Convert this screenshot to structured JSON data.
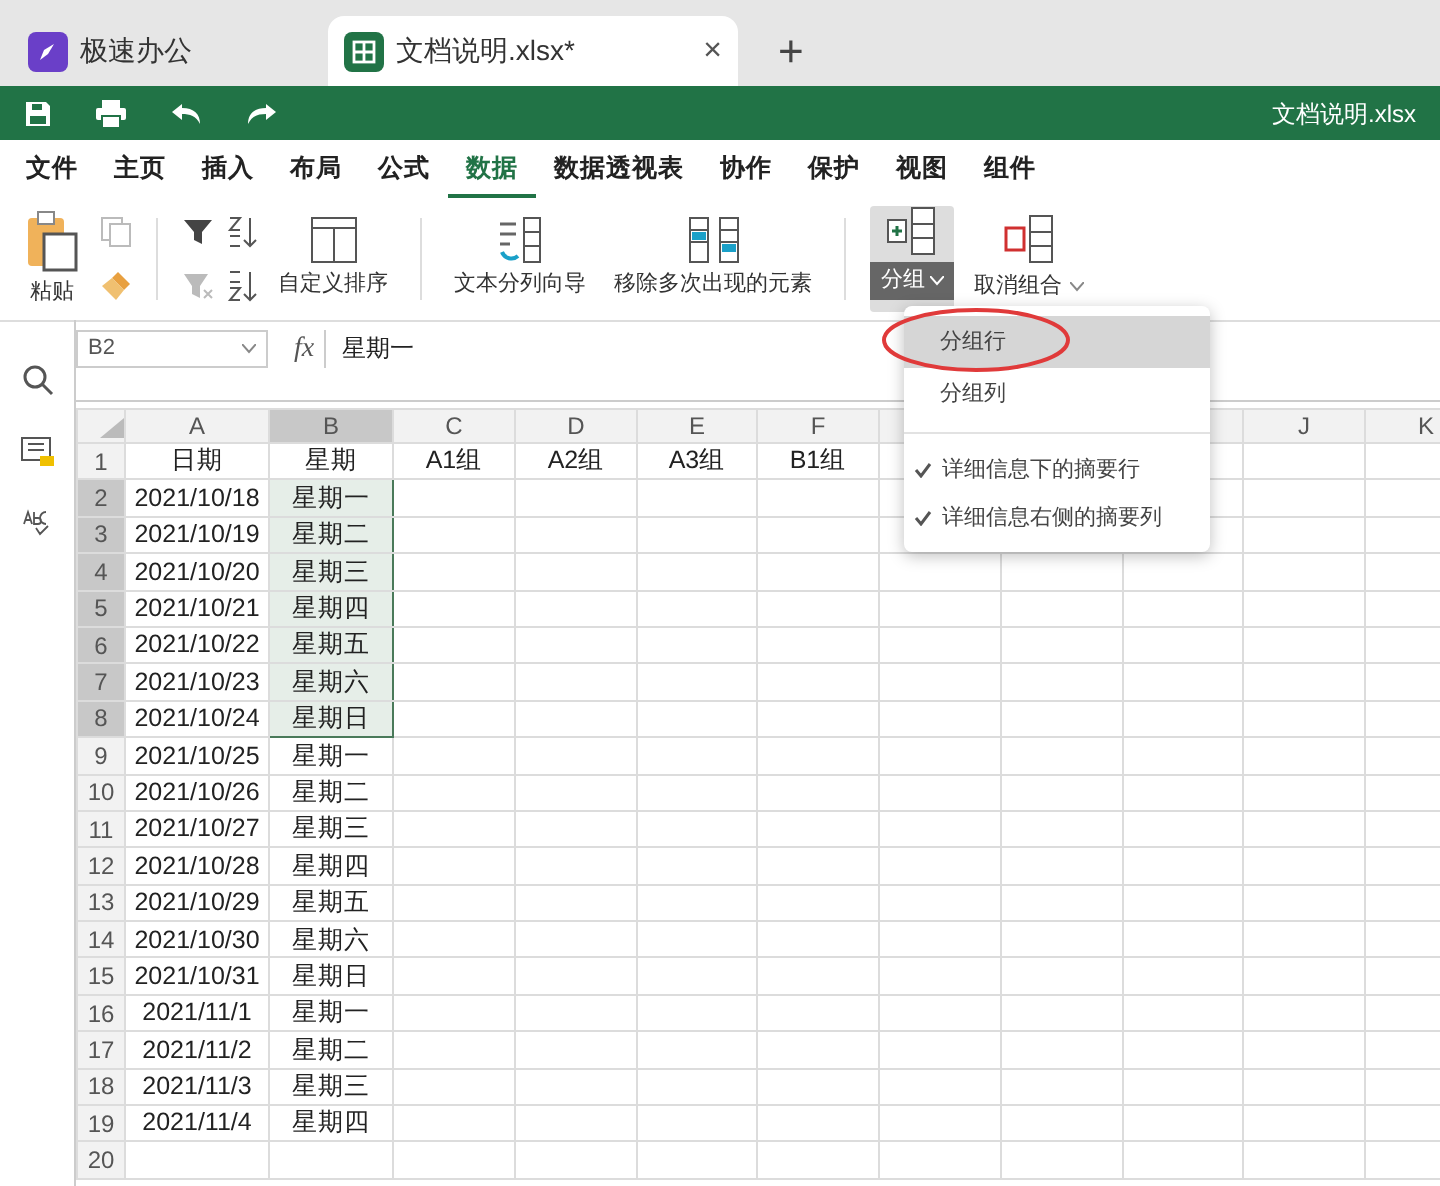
{
  "tabs": [
    {
      "label": "极速办公",
      "kind": "app",
      "selected": false
    },
    {
      "label": "文档说明.xlsx*",
      "kind": "doc",
      "selected": true,
      "close": "×"
    }
  ],
  "new_tab": "+",
  "title_bar": {
    "title": "文档说明.xlsx"
  },
  "menu": [
    {
      "label": "文件",
      "selected": false
    },
    {
      "label": "主页",
      "selected": false
    },
    {
      "label": "插入",
      "selected": false
    },
    {
      "label": "布局",
      "selected": false
    },
    {
      "label": "公式",
      "selected": false
    },
    {
      "label": "数据",
      "selected": true
    },
    {
      "label": "数据透视表",
      "selected": false
    },
    {
      "label": "协作",
      "selected": false
    },
    {
      "label": "保护",
      "selected": false
    },
    {
      "label": "视图",
      "selected": false
    },
    {
      "label": "组件",
      "selected": false
    }
  ],
  "ribbon": {
    "paste": "粘贴",
    "custom_sort": "自定义排序",
    "text_to_columns": "文本分列向导",
    "remove_duplicates": "移除多次出现的元素",
    "group": {
      "label": "分组",
      "expanded": true
    },
    "ungroup": {
      "label": "取消组合"
    }
  },
  "formula_bar": {
    "cell_ref": "B2",
    "fx": "fx",
    "value": "星期一"
  },
  "sheet": {
    "columns": [
      {
        "label": "A",
        "selected": false
      },
      {
        "label": "B",
        "selected": true
      },
      {
        "label": "C",
        "selected": false
      },
      {
        "label": "D",
        "selected": false
      },
      {
        "label": "E",
        "selected": false
      },
      {
        "label": "F",
        "selected": false
      },
      {
        "selected": false
      },
      {},
      {
        "selected": false
      },
      {
        "label": "J",
        "selected": false
      },
      {
        "label": "K",
        "selected": false
      }
    ],
    "rows": [
      {
        "number": "1",
        "selected": false,
        "cells": [
          "日期",
          "星期",
          "A1组",
          "A2组",
          "A3组",
          "B1组"
        ]
      },
      {
        "number": "2",
        "selected": true,
        "cells": [
          "2021/10/18",
          "星期一"
        ]
      },
      {
        "number": "3",
        "selected": true,
        "cells": [
          "2021/10/19",
          "星期二"
        ]
      },
      {
        "number": "4",
        "selected": true,
        "cells": [
          "2021/10/20",
          "星期三"
        ]
      },
      {
        "number": "5",
        "selected": true,
        "cells": [
          "2021/10/21",
          "星期四"
        ]
      },
      {
        "number": "6",
        "selected": true,
        "cells": [
          "2021/10/22",
          "星期五"
        ]
      },
      {
        "number": "7",
        "selected": true,
        "cells": [
          "2021/10/23",
          "星期六"
        ]
      },
      {
        "number": "8",
        "selected": true,
        "cells": [
          "2021/10/24",
          "星期日"
        ]
      },
      {
        "number": "9",
        "selected": false,
        "cells": [
          "2021/10/25",
          "星期一"
        ]
      },
      {
        "number": "10",
        "selected": false,
        "cells": [
          "2021/10/26",
          "星期二"
        ]
      },
      {
        "number": "11",
        "selected": false,
        "cells": [
          "2021/10/27",
          "星期三"
        ]
      },
      {
        "number": "12",
        "selected": false,
        "cells": [
          "2021/10/28",
          "星期四"
        ]
      },
      {
        "number": "13",
        "selected": false,
        "cells": [
          "2021/10/29",
          "星期五"
        ]
      },
      {
        "number": "14",
        "selected": false,
        "cells": [
          "2021/10/30",
          "星期六"
        ]
      },
      {
        "number": "15",
        "selected": false,
        "cells": [
          "2021/10/31",
          "星期日"
        ]
      },
      {
        "number": "16",
        "selected": false,
        "cells": [
          "2021/11/1",
          "星期一"
        ]
      },
      {
        "number": "17",
        "selected": false,
        "cells": [
          "2021/11/2",
          "星期二"
        ]
      },
      {
        "number": "18",
        "selected": false,
        "cells": [
          "2021/11/3",
          "星期三"
        ]
      },
      {
        "number": "19",
        "selected": false,
        "cells": [
          "2021/11/4",
          "星期四"
        ]
      },
      {
        "number": "20",
        "selected": false,
        "cells": []
      }
    ]
  },
  "group_menu": [
    {
      "label": "分组行",
      "kind": "item",
      "selected": true,
      "circled": true
    },
    {
      "label": "分组列",
      "kind": "item",
      "selected": false,
      "circled": false
    },
    {
      "label": "详细信息下的摘要行",
      "kind": "check",
      "checked": true
    },
    {
      "label": "详细信息右侧的摘要列",
      "kind": "check",
      "checked": true
    }
  ]
}
